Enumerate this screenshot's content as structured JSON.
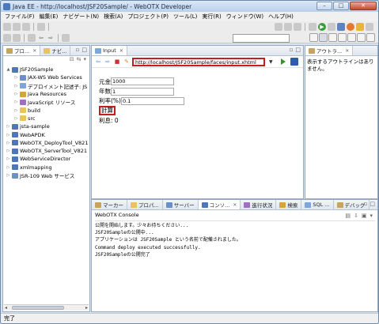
{
  "window": {
    "title": "Java EE - http://localhost/JSF20Sample/ - WebOTX Developer"
  },
  "menu": [
    "ファイル(F)",
    "編集(E)",
    "ナビゲート(N)",
    "検索(A)",
    "プロジェクト(P)",
    "ツール(L)",
    "実行(R)",
    "ウィンドウ(W)",
    "ヘルプ(H)"
  ],
  "explorer": {
    "tabs": [
      "プロ...",
      "ナビ..."
    ],
    "tree": [
      {
        "label": "JSF20Sample",
        "level": 0,
        "twisty": "▲",
        "icon": "project-icon"
      },
      {
        "label": "JAX-WS Web Services",
        "level": 1,
        "twisty": "▷",
        "icon": "web-services-icon"
      },
      {
        "label": "デプロイメント記述子: JS",
        "level": 1,
        "twisty": "▷",
        "icon": "descriptor-icon"
      },
      {
        "label": "Java Resources",
        "level": 1,
        "twisty": "▷",
        "icon": "java-resources-icon"
      },
      {
        "label": "JavaScript リソース",
        "level": 1,
        "twisty": "▷",
        "icon": "javascript-icon"
      },
      {
        "label": "build",
        "level": 1,
        "twisty": "▷",
        "icon": "folder-icon"
      },
      {
        "label": "src",
        "level": 1,
        "twisty": "▷",
        "icon": "folder-icon"
      },
      {
        "label": "jsta-sample",
        "level": 0,
        "twisty": "▷",
        "icon": "project-icon"
      },
      {
        "label": "WebAPDK",
        "level": 0,
        "twisty": "▷",
        "icon": "project-icon"
      },
      {
        "label": "WebOTX_DeployTool_V821",
        "level": 0,
        "twisty": "▷",
        "icon": "project-icon"
      },
      {
        "label": "WebOTX_ServerTool_V821",
        "level": 0,
        "twisty": "▷",
        "icon": "project-icon"
      },
      {
        "label": "WebServiceDirector",
        "level": 0,
        "twisty": "▷",
        "icon": "project-icon"
      },
      {
        "label": "xmlmapping",
        "level": 0,
        "twisty": "▷",
        "icon": "project-icon"
      },
      {
        "label": "JSR-109 Web サービス",
        "level": 0,
        "twisty": "▷",
        "icon": "web-service-icon"
      }
    ]
  },
  "editor": {
    "tab_label": "Input",
    "url": "http://localhost/JSF20Sample/faces/input.xhtml",
    "form": {
      "principal_label": "元金",
      "principal_value": "1000",
      "years_label": "年数",
      "years_value": "1",
      "rate_label": "利率(%)",
      "rate_value": "0.1",
      "calc_button": "計算",
      "interest_label": "利息",
      "interest_value": ": 0"
    }
  },
  "outline": {
    "tab_label": "アウトラ...",
    "message": "表示するアウトラインはありません。"
  },
  "bottom": {
    "tabs": [
      "マーカー",
      "プロパ...",
      "サーバー",
      "コンソ...",
      "進行状況",
      "検索",
      "SQL ...",
      "デバッグ"
    ],
    "console_title": "WebOTX Console",
    "console_lines": [
      "公開を開始します。少々お待ちください...",
      "JSF20Sampleの公開中...",
      "アプリケーションは JSF20Sample という名前で配備されました。",
      "Command deploy executed successfully.",
      "JSF20Sampleの公開完了"
    ]
  },
  "status": {
    "text": "完了"
  }
}
